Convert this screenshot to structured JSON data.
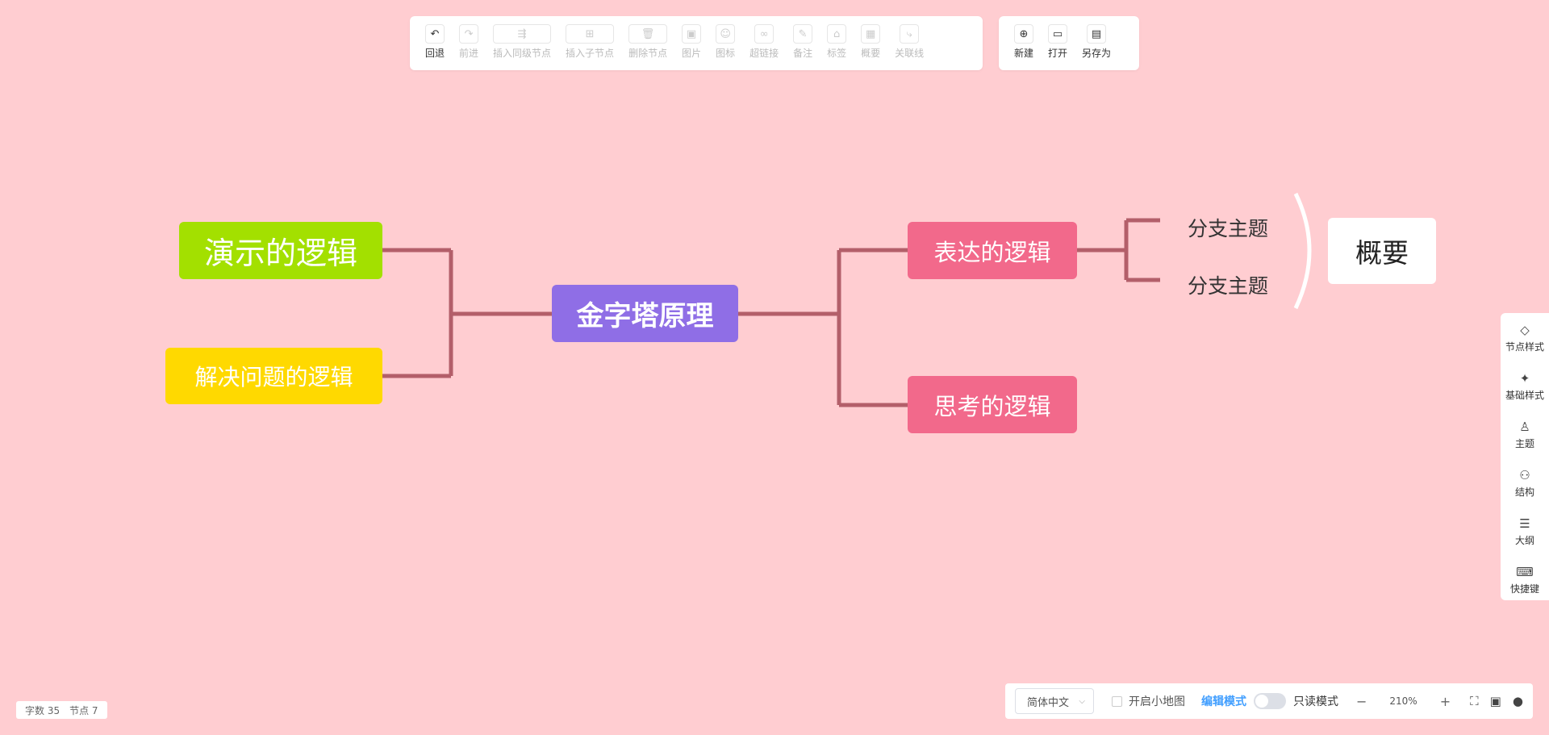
{
  "toolbar_main": {
    "items": [
      {
        "label": "回退",
        "icon": "undo-icon",
        "glyph": "↶"
      },
      {
        "label": "前进",
        "icon": "redo-icon",
        "glyph": "↷"
      },
      {
        "label": "插入同级节点",
        "icon": "insert-sibling-icon",
        "glyph": "⇶"
      },
      {
        "label": "插入子节点",
        "icon": "insert-child-icon",
        "glyph": "⊞"
      },
      {
        "label": "删除节点",
        "icon": "trash-icon",
        "glyph": "🗑"
      },
      {
        "label": "图片",
        "icon": "image-icon",
        "glyph": "▣"
      },
      {
        "label": "图标",
        "icon": "emoji-icon",
        "glyph": "☺"
      },
      {
        "label": "超链接",
        "icon": "link-icon",
        "glyph": "∞"
      },
      {
        "label": "备注",
        "icon": "note-icon",
        "glyph": "✎"
      },
      {
        "label": "标签",
        "icon": "tag-icon",
        "glyph": "⌂"
      },
      {
        "label": "概要",
        "icon": "summary-icon",
        "glyph": "▦"
      },
      {
        "label": "关联线",
        "icon": "relation-line-icon",
        "glyph": "⤷"
      }
    ]
  },
  "toolbar_file": {
    "items": [
      {
        "label": "新建",
        "icon": "new-file-icon",
        "glyph": "⊕"
      },
      {
        "label": "打开",
        "icon": "folder-open-icon",
        "glyph": "▭"
      },
      {
        "label": "另存为",
        "icon": "save-as-icon",
        "glyph": "▤"
      }
    ]
  },
  "mindmap": {
    "root": "金字塔原理",
    "left": [
      "演示的逻辑",
      "解决问题的逻辑"
    ],
    "right": [
      "表达的逻辑",
      "思考的逻辑"
    ],
    "branch_topics": [
      "分支主题",
      "分支主题"
    ],
    "summary": "概要",
    "colors": {
      "root": "#8f6ee6",
      "left_1": "#a3e000",
      "left_2": "#ffd900",
      "right": "#f2698b",
      "line": "#b35f6a"
    }
  },
  "side_panel": {
    "items": [
      {
        "label": "节点样式",
        "icon": "node-style-icon",
        "glyph": "◇"
      },
      {
        "label": "基础样式",
        "icon": "magic-wand-icon",
        "glyph": "✦"
      },
      {
        "label": "主题",
        "icon": "shirt-icon",
        "glyph": "♙"
      },
      {
        "label": "结构",
        "icon": "structure-icon",
        "glyph": "⚇"
      },
      {
        "label": "大纲",
        "icon": "outline-icon",
        "glyph": "☰"
      },
      {
        "label": "快捷键",
        "icon": "keyboard-icon",
        "glyph": "⌨"
      }
    ]
  },
  "status": {
    "word_count": "字数 35",
    "node_count": "节点 7"
  },
  "bottom_bar": {
    "language": "简体中文",
    "minimap_label": "开启小地图",
    "edit_mode": "编辑模式",
    "readonly_mode": "只读模式",
    "zoom_out": "−",
    "zoom": "210%",
    "zoom_in": "+"
  }
}
